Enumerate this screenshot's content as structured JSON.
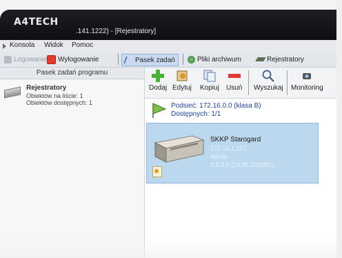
{
  "window": {
    "brand": "A4TECH",
    "title_partial": ".141.1222) - [Rejestratory]"
  },
  "menu": {
    "items": [
      "Konsola",
      "Widok",
      "Pomoc"
    ]
  },
  "toolbar": {
    "logowanie": "Logowanie",
    "wylogowanie": "Wylogowanie",
    "pasek_zadan": "Pasek zadań",
    "pliki_archiwum": "Pliki archiwum",
    "rejestratory": "Rejestratory"
  },
  "left_panel": {
    "header": "Pasek zadań programu",
    "item_title": "Rejestratory",
    "stat_on_list": "Obiektów na liście: 1",
    "stat_available": "Obiektów dostępnych: 1"
  },
  "actions": {
    "dodaj": "Dodaj",
    "edytuj": "Edytuj",
    "kopiuj": "Kopiuj",
    "usun": "Usuń",
    "wyszukaj": "Wyszukaj",
    "monitoring": "Monitoring"
  },
  "subnet": {
    "line1": "Podsieć: 172.16.0.0 (klasa B)",
    "line2": "Dostępnych: 1/1"
  },
  "device": {
    "name": "SKKP Starogard",
    "ip": "172.16.1.117",
    "user": "admin",
    "version": "2.3.3.5 (14.05.2020PC)"
  },
  "colors": {
    "titlebar": "#121317",
    "selection": "#bcd8ef",
    "link_blue": "#1f3fa0"
  }
}
